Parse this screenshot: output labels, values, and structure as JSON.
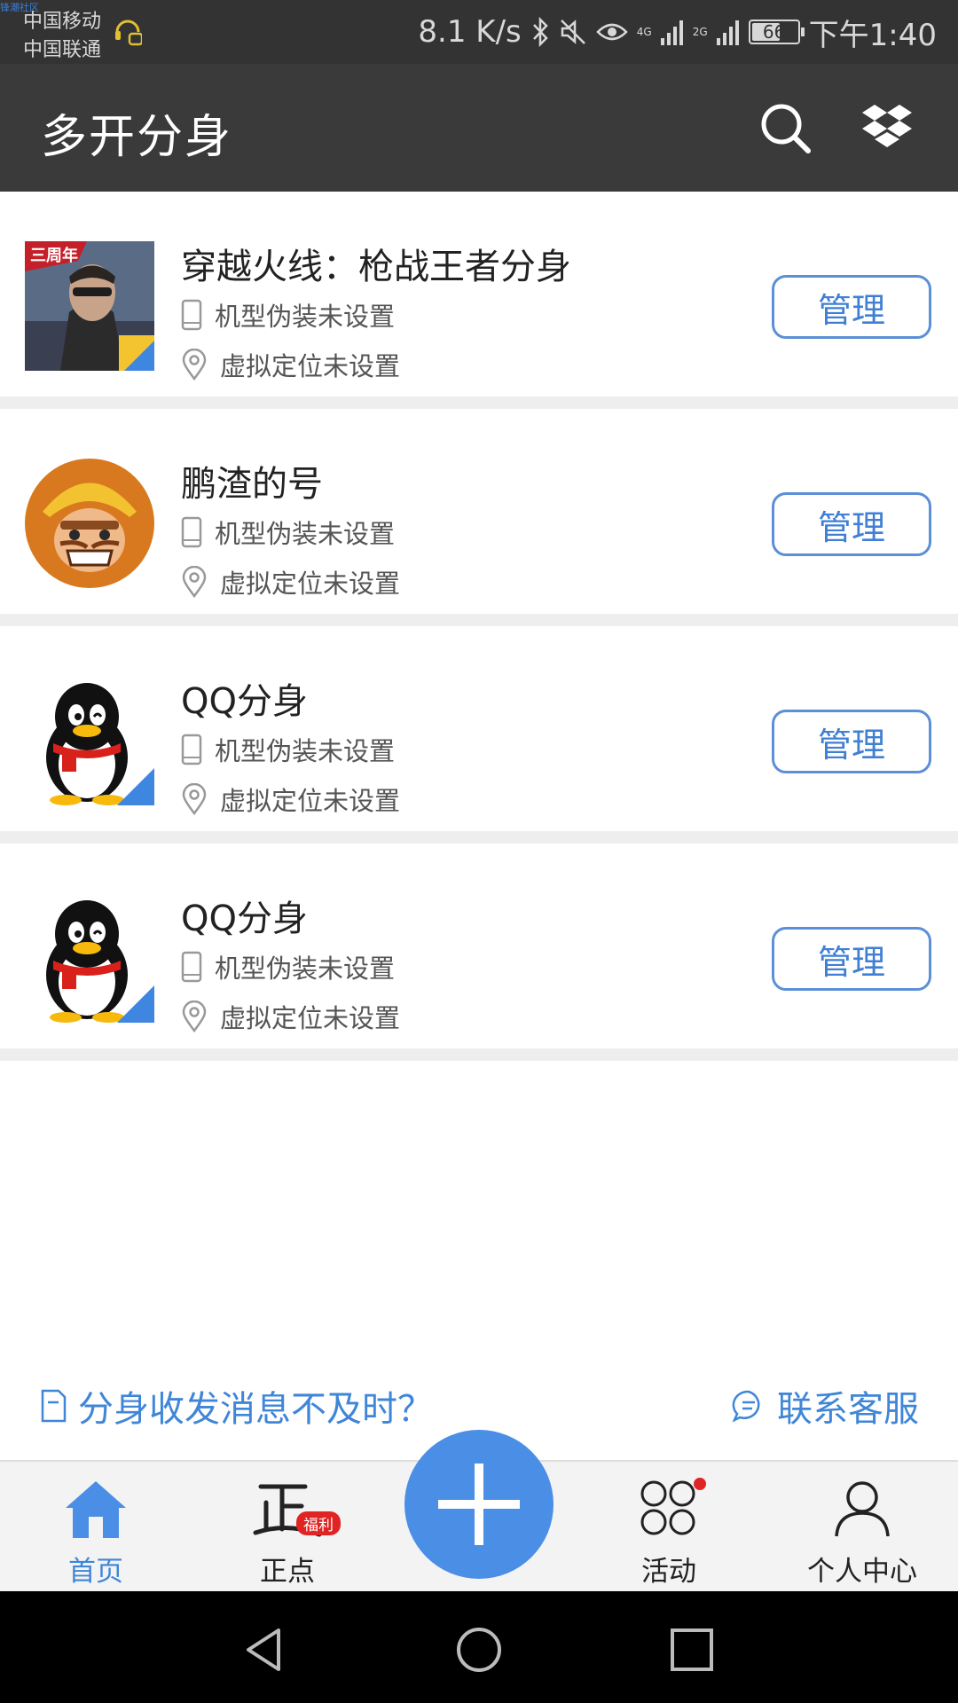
{
  "status_bar": {
    "watermark": "锋潮社区",
    "carrier_1": "中国移动",
    "carrier_2": "中国联通",
    "speed": "8.1 K/s",
    "net1": "4G",
    "net2": "2G",
    "battery": "66",
    "battery_level": 0.66,
    "time": "下午1:40"
  },
  "app_bar": {
    "title": "多开分身",
    "icons": [
      "search-icon",
      "dropbox-icon"
    ]
  },
  "clones": [
    {
      "name": "穿越火线：枪战王者分身",
      "device": "机型伪装未设置",
      "location": "虚拟定位未设置",
      "action": "管理",
      "icon": "cf-game-icon"
    },
    {
      "name": "鹏渣的号",
      "device": "机型伪装未设置",
      "location": "虚拟定位未设置",
      "action": "管理",
      "icon": "clash-of-clans-icon"
    },
    {
      "name": "QQ分身",
      "device": "机型伪装未设置",
      "location": "虚拟定位未设置",
      "action": "管理",
      "icon": "qq-penguin-icon"
    },
    {
      "name": "QQ分身",
      "device": "机型伪装未设置",
      "location": "虚拟定位未设置",
      "action": "管理",
      "icon": "qq-penguin-icon"
    }
  ],
  "help": {
    "question": "分身收发消息不及时？",
    "contact": "联系客服"
  },
  "bottom_nav": {
    "home": "首页",
    "zhengdian": "正点",
    "zhengdian_badge": "福利",
    "activity": "活动",
    "profile": "个人中心"
  },
  "colors": {
    "accent": "#4a8ee6",
    "app_bar": "#3a3a3a",
    "status_bar": "#333333"
  }
}
